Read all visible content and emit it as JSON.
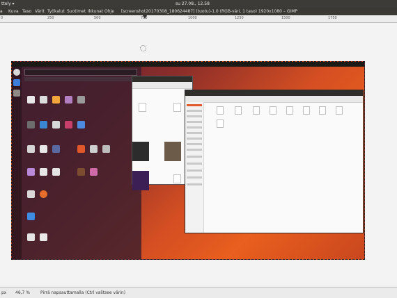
{
  "top_panel": {
    "app_name": "ttely ▾",
    "clock": "su 27.08., 12.58"
  },
  "menubar": {
    "items": [
      "a",
      "Kuva",
      "Taso",
      "Värit",
      "Työkalut",
      "Suotimet",
      "Ikkunat",
      "Ohje"
    ]
  },
  "window_title": "[screenshot20170308_180624487] (tuotu)-1.0 (RGB-väri, 1 taso) 1920x1080 – GIMP",
  "ruler": {
    "ticks": [
      "0",
      "250",
      "500",
      "750",
      "1000",
      "1250",
      "1500",
      "1750"
    ]
  },
  "statusbar": {
    "unit": "px",
    "zoom": "46,7 %",
    "hint": "Pirrä napsauttamalla (Ctrl valitsee värin)"
  },
  "colors": {
    "panel": "#3c3b37",
    "canvas": "#f3f3f3",
    "desktop_orange": "#e95f1e",
    "desktop_purple": "#5b1f3b"
  }
}
